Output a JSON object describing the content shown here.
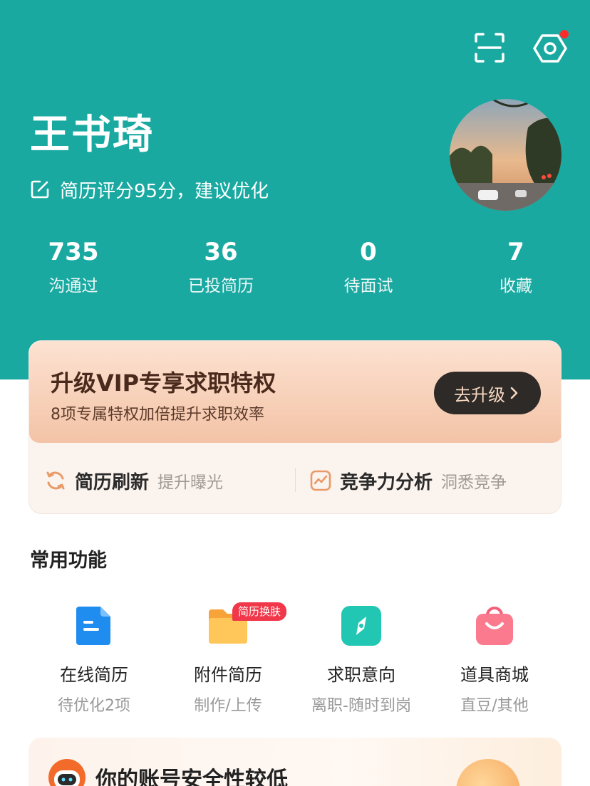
{
  "profile": {
    "name": "王书琦",
    "resume_hint": "简历评分95分，建议优化"
  },
  "stats": [
    {
      "value": "735",
      "label": "沟通过"
    },
    {
      "value": "36",
      "label": "已投简历"
    },
    {
      "value": "0",
      "label": "待面试"
    },
    {
      "value": "7",
      "label": "收藏"
    }
  ],
  "vip": {
    "title": "升级VIP专享求职特权",
    "subtitle": "8项专属特权加倍提升求职效率",
    "button": "去升级",
    "features": [
      {
        "title": "简历刷新",
        "sub": "提升曝光"
      },
      {
        "title": "竞争力分析",
        "sub": "洞悉竞争"
      }
    ]
  },
  "section_title": "常用功能",
  "functions": [
    {
      "label": "在线简历",
      "sub": "待优化2项"
    },
    {
      "label": "附件简历",
      "sub": "制作/上传",
      "badge": "简历换肤"
    },
    {
      "label": "求职意向",
      "sub": "离职-随时到岗"
    },
    {
      "label": "道具商城",
      "sub": "直豆/其他"
    }
  ],
  "security_banner": {
    "title": "你的账号安全性较低"
  },
  "colors": {
    "header_bg": "#1aa9a1",
    "vip_button_bg": "#2d2a28",
    "badge_red": "#f0384a"
  }
}
